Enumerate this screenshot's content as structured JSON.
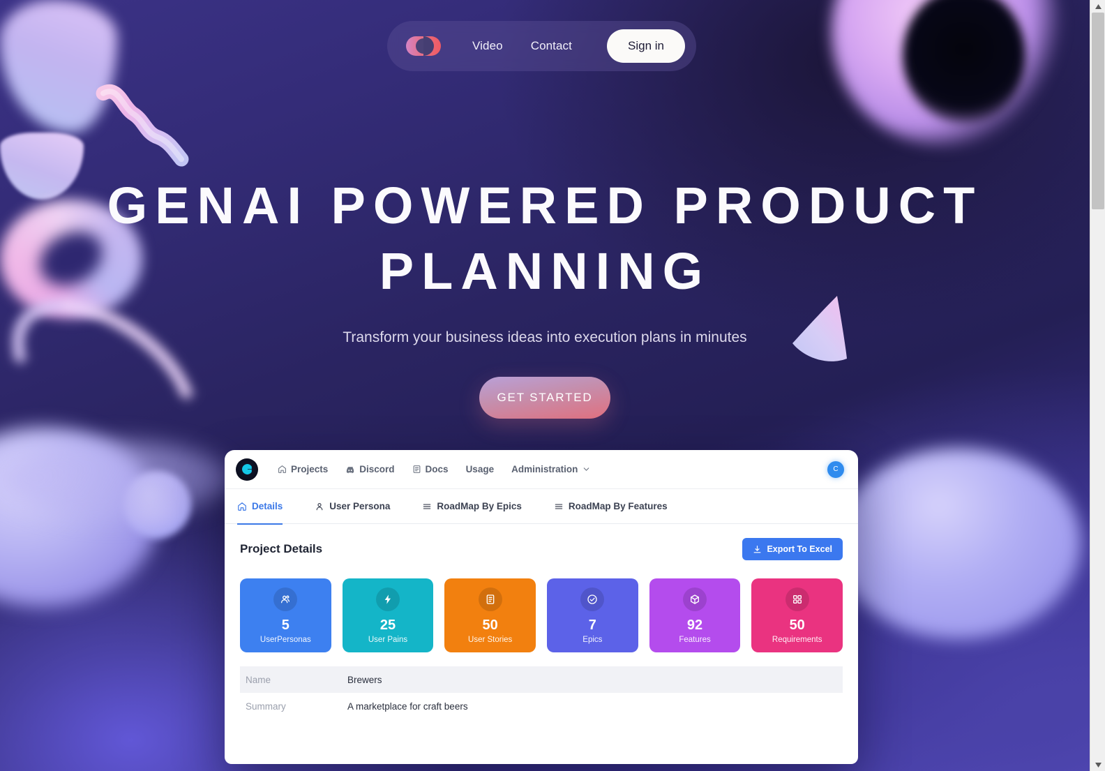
{
  "site": {
    "logo_icon": "brand-c-logo",
    "nav_links": [
      {
        "label": "Video"
      },
      {
        "label": "Contact"
      }
    ],
    "signin_label": "Sign in"
  },
  "hero": {
    "title": "GenAI Powered Product Planning",
    "subtitle": "Transform your business ideas into execution plans in minutes",
    "cta_label": "GET STARTED"
  },
  "app": {
    "logo_icon": "app-c-logo",
    "nav_items": [
      {
        "label": "Projects",
        "icon": "home-icon"
      },
      {
        "label": "Discord",
        "icon": "discord-icon"
      },
      {
        "label": "Docs",
        "icon": "document-icon"
      },
      {
        "label": "Usage",
        "icon": ""
      },
      {
        "label": "Administration",
        "icon": "chevron-down-icon"
      }
    ],
    "avatar_initial": "C",
    "tabs": [
      {
        "label": "Details",
        "icon": "home-icon",
        "active": true
      },
      {
        "label": "User Persona",
        "icon": "person-icon",
        "active": false
      },
      {
        "label": "RoadMap By Epics",
        "icon": "list-icon",
        "active": false
      },
      {
        "label": "RoadMap By Features",
        "icon": "list-icon",
        "active": false
      }
    ],
    "panel_title": "Project Details",
    "export_label": "Export To Excel",
    "export_icon": "download-icon",
    "stats": [
      {
        "value": "5",
        "label": "UserPersonas",
        "color": "#3d80f0",
        "icon": "users-icon"
      },
      {
        "value": "25",
        "label": "User Pains",
        "color": "#14b5c8",
        "icon": "lightning-icon"
      },
      {
        "value": "50",
        "label": "User Stories",
        "color": "#f2800f",
        "icon": "document-icon"
      },
      {
        "value": "7",
        "label": "Epics",
        "color": "#5c62e8",
        "icon": "check-circle-icon"
      },
      {
        "value": "92",
        "label": "Features",
        "color": "#b44ced",
        "icon": "box-icon"
      },
      {
        "value": "50",
        "label": "Requirements",
        "color": "#ea3380",
        "icon": "grid-icon"
      }
    ],
    "rows": [
      {
        "key": "Name",
        "value": "Brewers"
      },
      {
        "key": "Summary",
        "value": "A marketplace for craft beers"
      }
    ]
  },
  "colors": {
    "accent_blue": "#3b78ef",
    "brand_pink": "#e0707f",
    "hero_bg_dark": "#241f55",
    "hero_bg_light": "#5b52c8"
  },
  "scrollbar": {
    "up_arrow": "scroll-up-arrow",
    "down_arrow": "scroll-down-arrow"
  }
}
